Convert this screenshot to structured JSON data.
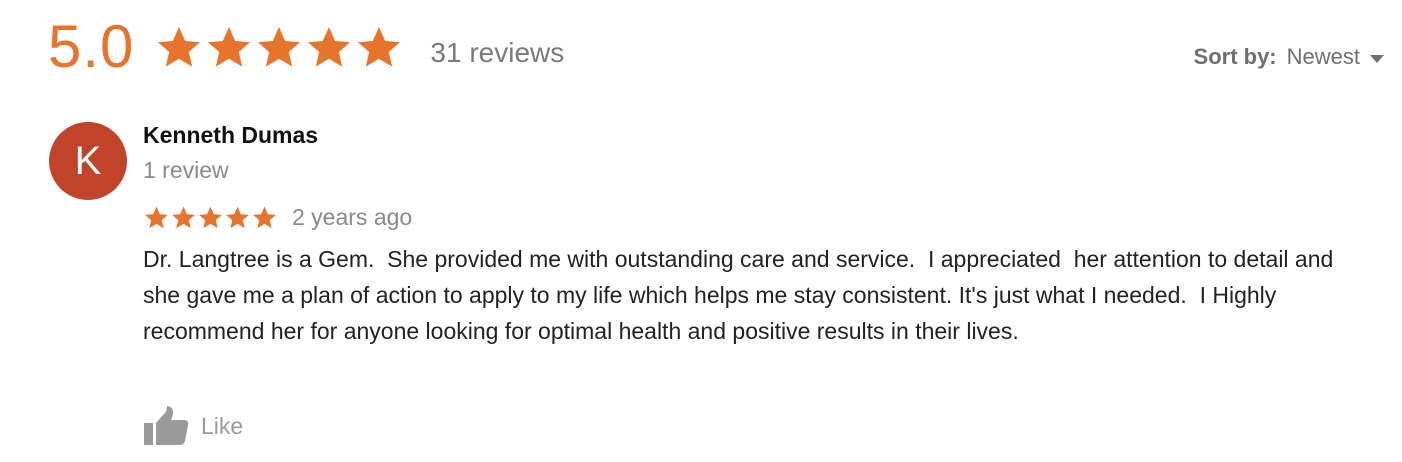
{
  "summary": {
    "rating": "5.0",
    "stars": 5,
    "review_count": "31 reviews",
    "star_color": "#e8742c"
  },
  "sort": {
    "label": "Sort by:",
    "value": "Newest",
    "caret_icon": "caret-down-icon"
  },
  "review": {
    "avatar_letter": "K",
    "avatar_color": "#c1432a",
    "reviewer_name": "Kenneth Dumas",
    "reviewer_review_count": "1 review",
    "stars": 5,
    "date": "2 years ago",
    "text": "Dr. Langtree is a Gem.  She provided me with outstanding care and service.  I appreciated  her attention to detail and she gave me a plan of action to apply to my life which helps me stay consistent. It's just what I needed.  I Highly recommend her for anyone looking for optimal health and positive results in their lives.",
    "like_label": "Like",
    "like_icon": "thumbs-up-icon"
  }
}
